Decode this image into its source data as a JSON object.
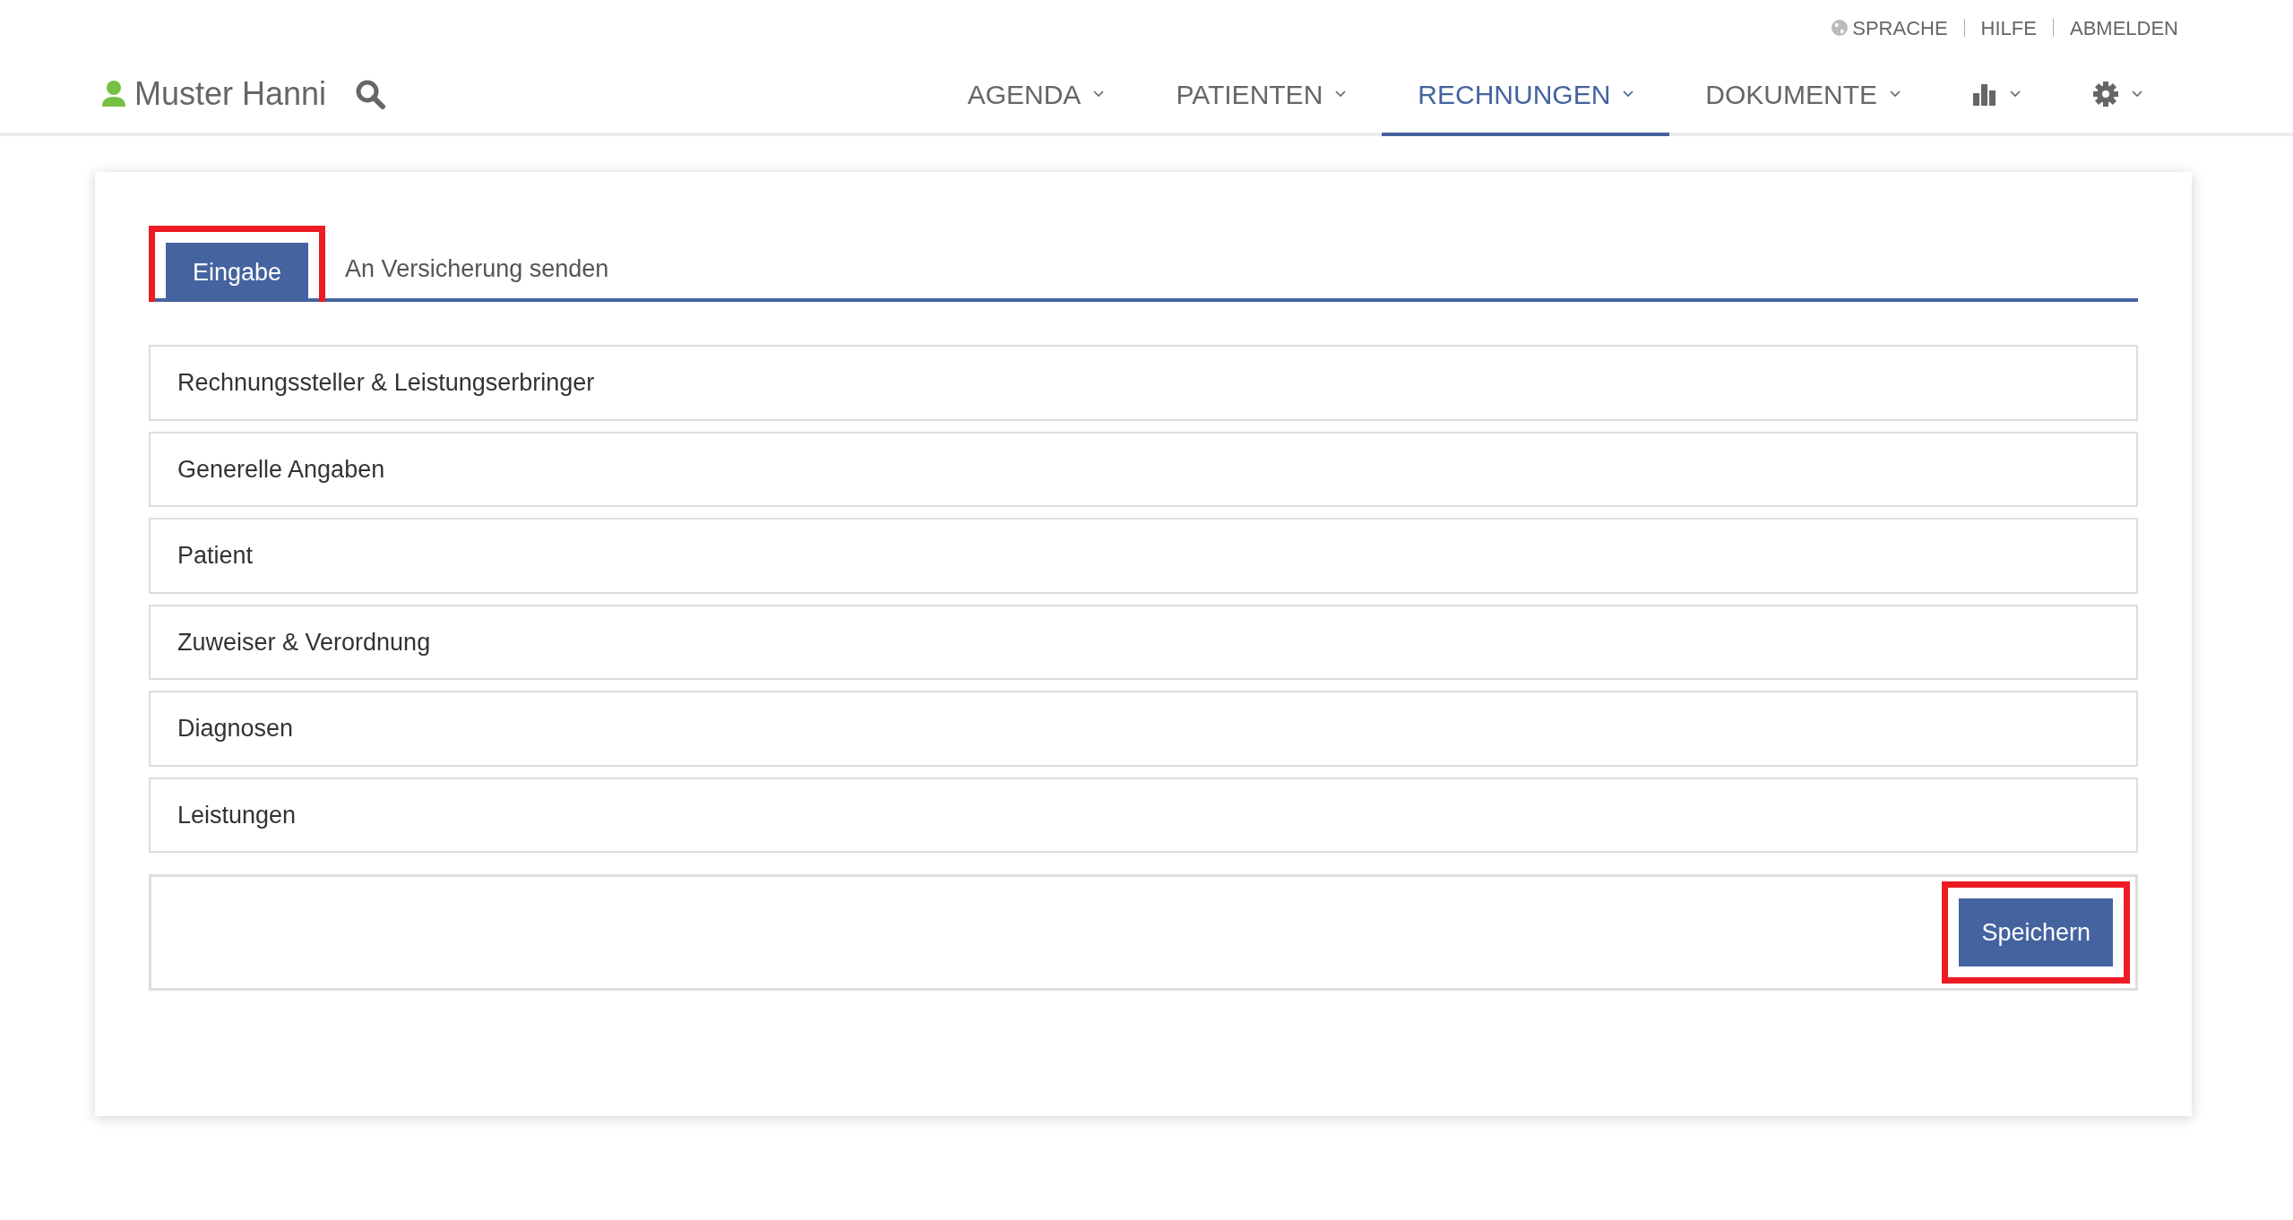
{
  "top_links": [
    {
      "kind": "globe",
      "label": "SPRACHE"
    },
    {
      "kind": "text",
      "label": "HILFE"
    },
    {
      "kind": "text",
      "label": "ABMELDEN"
    }
  ],
  "user": {
    "name": "Muster Hanni"
  },
  "nav": [
    {
      "kind": "text",
      "label": "AGENDA",
      "selected": false
    },
    {
      "kind": "text",
      "label": "PATIENTEN",
      "selected": false
    },
    {
      "kind": "text",
      "label": "RECHNUNGEN",
      "selected": true
    },
    {
      "kind": "text",
      "label": "DOKUMENTE",
      "selected": false
    },
    {
      "kind": "chart",
      "selected": false
    },
    {
      "kind": "gear",
      "selected": false
    }
  ],
  "tabs": [
    {
      "label": "Eingabe",
      "selected": true,
      "highlighted": true
    },
    {
      "label": "An Versicherung senden",
      "selected": false,
      "highlighted": false
    }
  ],
  "sections": [
    "Rechnungssteller & Leistungserbringer",
    "Generelle Angaben",
    "Patient",
    "Zuweiser & Verordnung",
    "Diagnosen",
    "Leistungen"
  ],
  "save_button": {
    "label": "Speichern",
    "highlighted": true
  }
}
